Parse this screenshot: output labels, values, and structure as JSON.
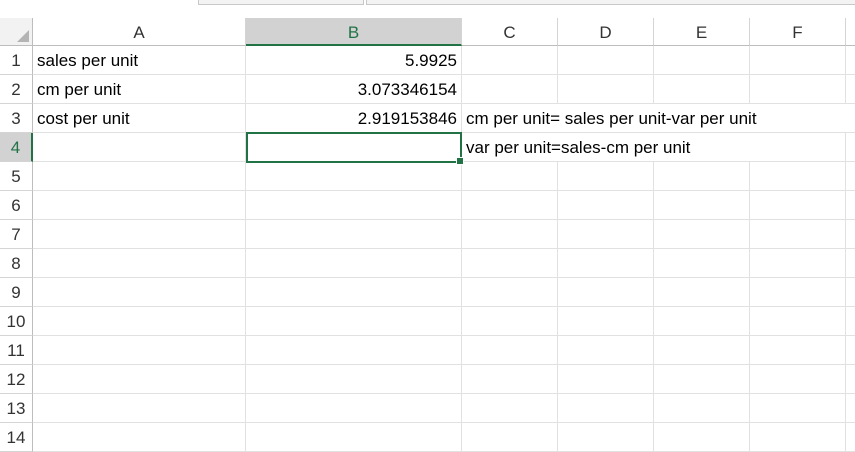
{
  "columns": [
    "A",
    "B",
    "C",
    "D",
    "E",
    "F"
  ],
  "rows": [
    "1",
    "2",
    "3",
    "4",
    "5",
    "6",
    "7",
    "8",
    "9",
    "10",
    "11",
    "12",
    "13",
    "14"
  ],
  "cells": {
    "A1": "sales per unit",
    "B1": "5.9925",
    "A2": "cm per unit",
    "B2": "3.073346154",
    "A3": "cost per unit",
    "B3": "2.919153846",
    "C3": "cm per unit= sales per unit-var per unit",
    "C4": "var per unit=sales-cm per unit"
  },
  "selection": {
    "active_cell": "B4",
    "active_column": "B",
    "active_row": "4"
  },
  "colors": {
    "accent": "#217346",
    "header_selected": "#d2d2d2",
    "gridline": "#e1e1e1"
  }
}
